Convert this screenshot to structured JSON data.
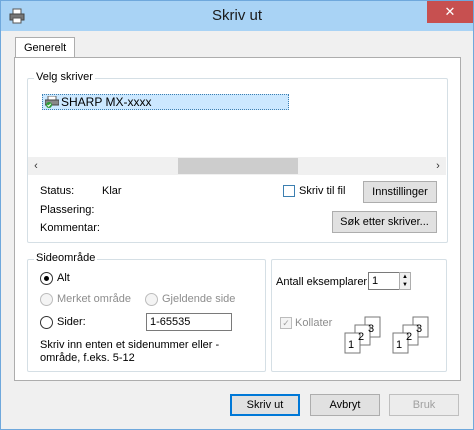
{
  "window": {
    "title": "Skriv ut",
    "close_glyph": "✕"
  },
  "tabs": [
    {
      "label": "Generelt",
      "selected": true
    }
  ],
  "select_printer": {
    "legend": "Velg skriver",
    "printers": [
      {
        "name": "SHARP MX-xxxx",
        "icon": "printer-icon",
        "selected": true
      }
    ],
    "scroll_left": "‹",
    "scroll_right": "›",
    "status_label": "Status:",
    "status_value": "Klar",
    "location_label": "Plassering:",
    "comment_label": "Kommentar:",
    "print_to_file_label": "Skriv til fil",
    "print_to_file_checked": false,
    "preferences_button": "Innstillinger",
    "find_printer_button": "Søk etter skriver..."
  },
  "page_range": {
    "legend": "Sideområde",
    "all_label": "Alt",
    "selection_label": "Merket område",
    "current_page_label": "Gjeldende side",
    "pages_label": "Sider:",
    "pages_value": "1-65535",
    "selected_option": "all",
    "hint": "Skriv inn enten et sidenummer eller -område, f.eks. 5-12"
  },
  "copies": {
    "label": "Antall eksemplarer:",
    "value": "1",
    "collate_label": "Kollater",
    "collate_checked": true,
    "collate_enabled": false,
    "collate_numbers": [
      "1",
      "2",
      "3"
    ]
  },
  "footer": {
    "print_button": "Skriv ut",
    "cancel_button": "Avbryt",
    "apply_button": "Bruk"
  }
}
